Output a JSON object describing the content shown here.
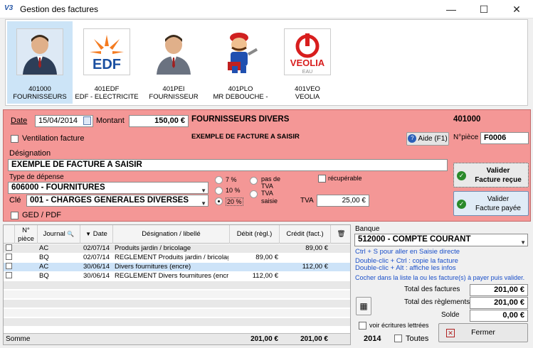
{
  "window": {
    "title": "Gestion des factures",
    "icon": "V3"
  },
  "suppliers": [
    {
      "code": "401000",
      "name": "FOURNISSEURS",
      "icon": "person-icon",
      "selected": true
    },
    {
      "code": "401EDF",
      "name": "EDF - ELECTRICITE",
      "icon": "edf-logo",
      "logo_text": "EDF",
      "selected": false
    },
    {
      "code": "401PEI",
      "name": "FOURNISSEUR",
      "icon": "person-icon",
      "selected": false
    },
    {
      "code": "401PLO",
      "name": "MR DEBOUCHE -",
      "icon": "plumber-icon",
      "selected": false
    },
    {
      "code": "401VEO",
      "name": "VEOLIA",
      "icon": "veolia-logo",
      "logo_text": "VEOLIA",
      "logo_sub": "EAU",
      "selected": false
    }
  ],
  "form": {
    "date_label": "Date",
    "date_value": "15/04/2014",
    "montant_label": "Montant",
    "montant_value": "150,00 €",
    "supplier_title": "FOURNISSEURS DIVERS",
    "supplier_code": "401000",
    "ventilation_label": "Ventilation facture",
    "example_text": "EXEMPLE DE FACTURE A SAISIR",
    "aide_label": "Aide (F1)",
    "npiece_label": "N°pièce",
    "npiece_value": "F0006",
    "designation_label": "Désignation",
    "designation_value": "EXEMPLE DE FACTURE A SAISIR",
    "type_label": "Type de dépense",
    "type_value": "606000 - FOURNITURES",
    "cle_label": "Clé",
    "cle_value": "001 - CHARGES GENERALES DIVERSES",
    "ged_label": "GED / PDF",
    "tva_rates": [
      {
        "label": "7 %",
        "selected": false
      },
      {
        "label": "10 %",
        "selected": false
      },
      {
        "label": "20 %",
        "selected": true
      }
    ],
    "pas_de_tva_label1": "pas de",
    "pas_de_tva_label2": "TVA",
    "tva_saisie_label1": "TVA",
    "tva_saisie_label2": "saisie",
    "recuperable_label": "récupérable",
    "tva_label": "TVA",
    "tva_value": "25,00 €",
    "valider_recue_1": "Valider",
    "valider_recue_2": "Facture reçue",
    "valider_payee_1": "Valider",
    "valider_payee_2": "Facture payée"
  },
  "grid": {
    "headers": {
      "npiece_1": "N°",
      "npiece_2": "pièce",
      "journal": "Journal",
      "date": "Date",
      "designation": "Désignation / libellé",
      "debit": "Débit (règl.)",
      "credit": "Crédit (fact.)"
    },
    "rows": [
      {
        "journal": "AC",
        "date": "02/07/14",
        "libelle": "Produits jardin / bricolage",
        "debit": "",
        "credit": "89,00 €",
        "highlight": false
      },
      {
        "journal": "BQ",
        "date": "02/07/14",
        "libelle": "REGLEMENT Produits jardin / bricolage",
        "debit": "89,00 €",
        "credit": "",
        "highlight": false
      },
      {
        "journal": "AC",
        "date": "30/06/14",
        "libelle": "Divers fournitures (encre)",
        "debit": "",
        "credit": "112,00 €",
        "highlight": true
      },
      {
        "journal": "BQ",
        "date": "30/06/14",
        "libelle": "REGLEMENT Divers fournitures (encre)",
        "debit": "112,00 €",
        "credit": "",
        "highlight": false
      }
    ],
    "footer": {
      "label": "Somme",
      "debit_total": "201,00 €",
      "credit_total": "201,00 €"
    }
  },
  "right": {
    "banque_label": "Banque",
    "banque_value": "512000 - COMPTE COURANT",
    "hint1": "Ctrl + S pour aller en Saisie directe",
    "hint2": "Double-clic + Ctrl : copie la facture",
    "hint3": "Double-clic + Alt : affiche les infos",
    "hint4": "Cocher dans la liste la ou les facture(s) à payer puis valider.",
    "total_factures_label": "Total des factures",
    "total_factures_value": "201,00 €",
    "total_reglements_label": "Total des règlements",
    "total_reglements_value": "201,00 €",
    "solde_label": "Solde",
    "solde_value": "0,00 €",
    "voir_ecritures_label": "voir écritures lettrées",
    "year": "2014",
    "toutes_label": "Toutes",
    "fermer_label": "Fermer"
  },
  "colors": {
    "form_bg": "#f49796",
    "accent_blue": "#1a4fc9",
    "selected_row": "#cde3f8"
  }
}
